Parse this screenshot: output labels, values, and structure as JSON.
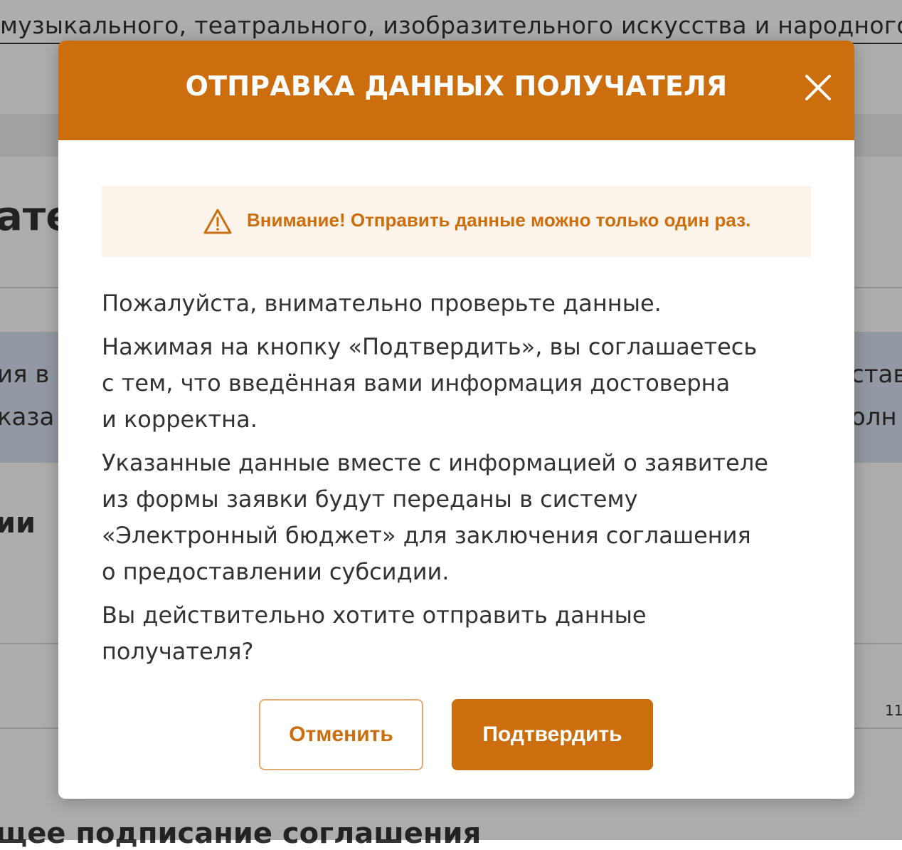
{
  "background": {
    "top_line": "музыкального, театрального, изобразительного искусства и народного",
    "heading_fragment": "ате",
    "blue_band": {
      "left_line_1": "ия в",
      "left_line_2": "каза",
      "right_line_1": "став",
      "right_line_2": "олн"
    },
    "subheading_fragment": "ии",
    "small_number": "11",
    "bottom_heading": "щее подписание соглашения"
  },
  "modal": {
    "title": "ОТПРАВКА ДАННЫХ ПОЛУЧАТЕЛЯ",
    "close_icon": "close-icon",
    "warning": {
      "icon": "warning-triangle-icon",
      "text": "Внимание! Отправить данные можно только один раз."
    },
    "paragraphs": {
      "p1": "Пожалуйста, внимательно проверьте данные.",
      "p2_line_1": "Нажимая на кнопку «Подтвердить», вы соглашаетесь",
      "p2_line_2": "с тем, что введённая вами информация достоверна",
      "p2_line_3": "и корректна.",
      "p3_line_1": "Указанные данные вместе с информацией о заявителе",
      "p3_line_2": "из формы заявки будут переданы в систему",
      "p3_line_3": "«Электронный бюджет» для заключения соглашения",
      "p3_line_4": "о предоставлении субсидии.",
      "p4_line_1": "Вы действительно хотите отправить данные",
      "p4_line_2": "получателя?"
    },
    "cancel_label": "Отменить",
    "confirm_label": "Подтвердить"
  },
  "colors": {
    "accent": "#cc6e0d",
    "warning_background": "#fcf3eb",
    "overlay": "rgba(0,0,0,0.32)"
  }
}
